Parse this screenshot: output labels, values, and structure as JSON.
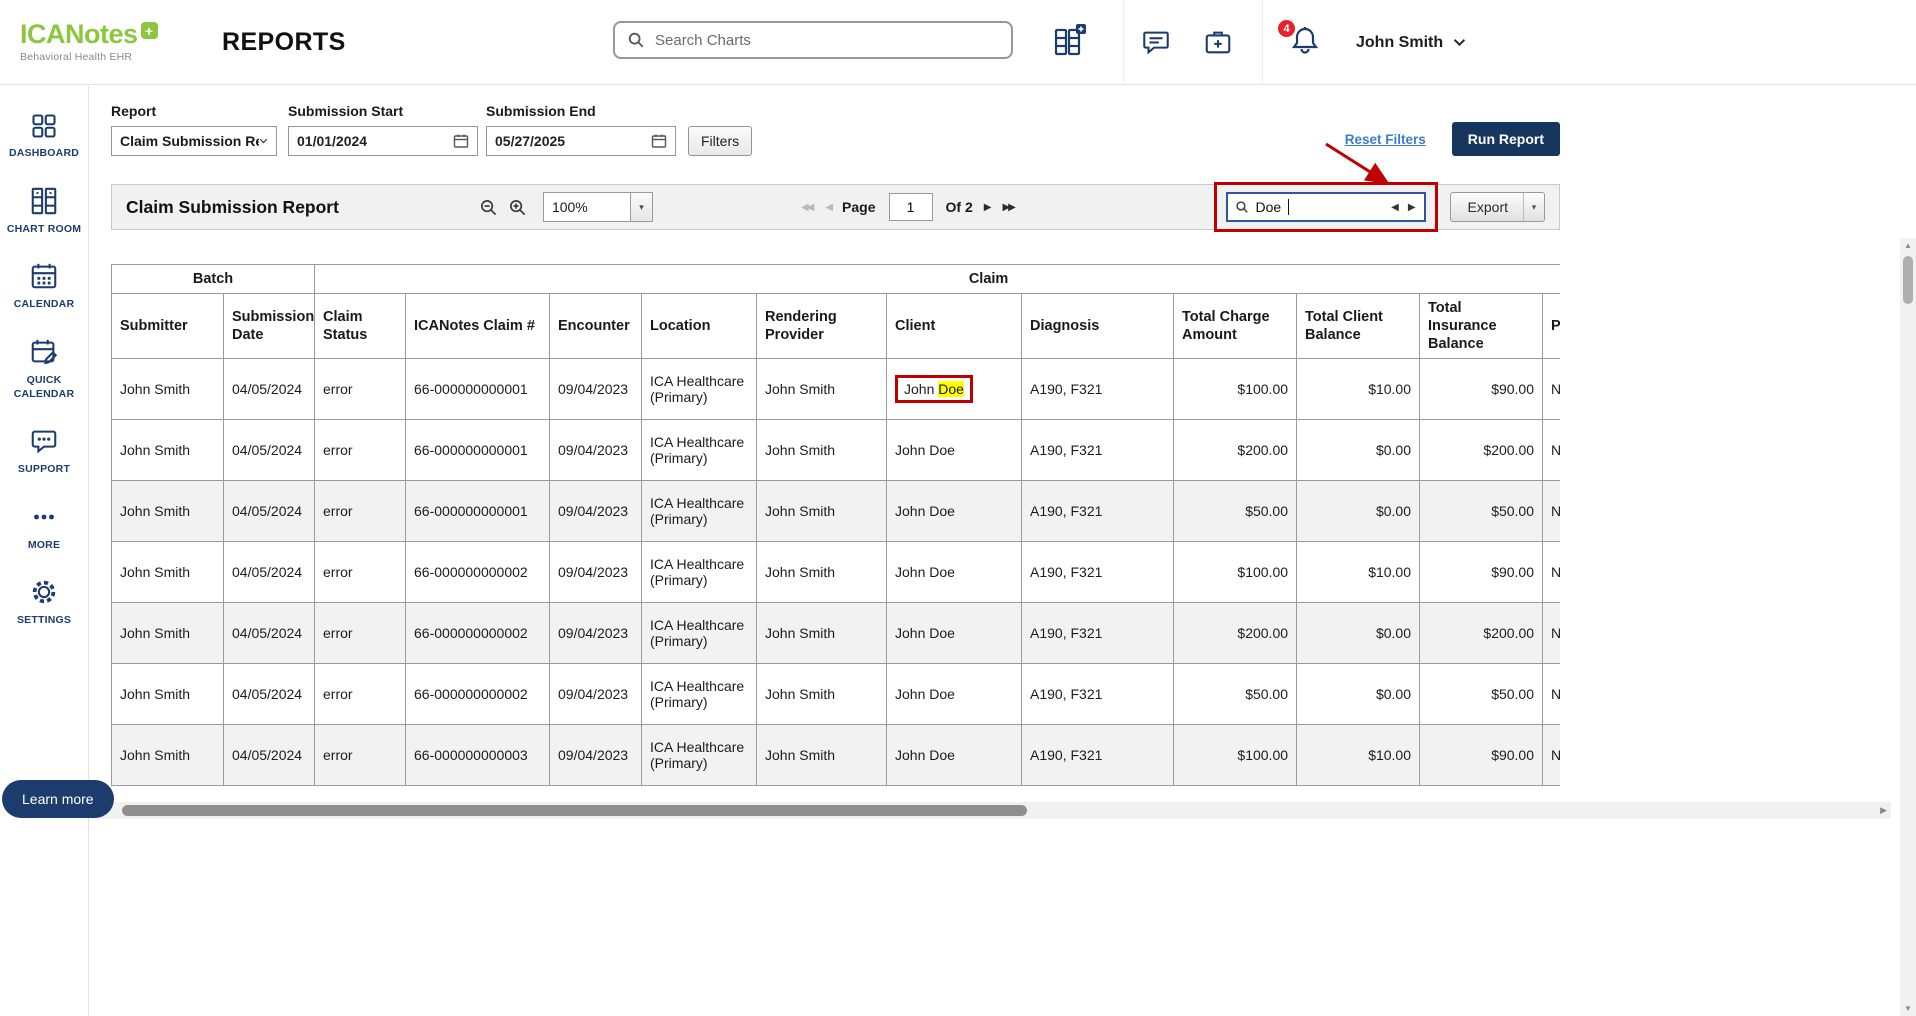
{
  "colors": {
    "accent_navy": "#1d3c6e",
    "button_navy": "#17365e",
    "logo_green": "#8dc63f",
    "annotation_red": "#c00000",
    "link_blue": "#3d7cc9",
    "highlight_yellow": "#ffff00",
    "badge_red": "#e8222d"
  },
  "header": {
    "logo_text": "ICANotes",
    "logo_plus": "+",
    "logo_tagline": "Behavioral Health EHR",
    "page_title": "REPORTS",
    "search_placeholder": "Search Charts",
    "notification_count": "4",
    "user_name": "John Smith"
  },
  "sidebar": {
    "items": [
      {
        "label": "DASHBOARD"
      },
      {
        "label": "CHART ROOM"
      },
      {
        "label": "CALENDAR"
      },
      {
        "label": "QUICK CALENDAR"
      },
      {
        "label": "SUPPORT"
      },
      {
        "label": "MORE"
      },
      {
        "label": "SETTINGS"
      }
    ],
    "learn_more_label": "Learn more"
  },
  "filters": {
    "report_label": "Report",
    "report_value": "Claim Submission Report",
    "start_label": "Submission Start",
    "start_value": "01/01/2024",
    "end_label": "Submission End",
    "end_value": "05/27/2025",
    "filters_button_label": "Filters",
    "reset_link_label": "Reset Filters",
    "run_button_label": "Run Report"
  },
  "toolbar": {
    "report_title": "Claim Submission Report",
    "zoom_value": "100%",
    "page_label": "Page",
    "page_value": "1",
    "page_total_label": "Of 2",
    "search_value": "Doe",
    "export_label": "Export"
  },
  "icons": {
    "first_page": "◀◀",
    "prev_page": "◀",
    "next_page": "▶",
    "last_page": "▶▶",
    "dropdown_arrow": "▾",
    "search_prev": "◀",
    "search_next": "▶",
    "hscroll_left": "◀",
    "hscroll_right": "▶",
    "vscroll_up": "▲",
    "vscroll_down": "▼"
  },
  "table": {
    "group_headers": [
      {
        "label": "Batch",
        "colspan": 2
      },
      {
        "label": "Claim",
        "colspan": 11
      }
    ],
    "columns": [
      "Submitter",
      "Submission Date",
      "Claim Status",
      "ICANotes Claim #",
      "Encounter",
      "Location",
      "Rendering Provider",
      "Client",
      "Diagnosis",
      "Total Charge Amount",
      "Total Client Balance",
      "Total Insurance Balance",
      "P"
    ],
    "rows": [
      {
        "submitter": "John Smith",
        "submission_date": "04/05/2024",
        "claim_status": "error",
        "claim_number": "66-000000000001",
        "encounter": "09/04/2023",
        "location": "ICA Healthcare (Primary)",
        "rendering_provider": "John Smith",
        "client": "John Doe",
        "diagnosis": "A190, F321",
        "total_charge": "$100.00",
        "total_client_balance": "$10.00",
        "total_insurance_balance": "$90.00",
        "partial": "N",
        "annotated": true
      },
      {
        "submitter": "John Smith",
        "submission_date": "04/05/2024",
        "claim_status": "error",
        "claim_number": "66-000000000001",
        "encounter": "09/04/2023",
        "location": "ICA Healthcare (Primary)",
        "rendering_provider": "John Smith",
        "client": "John Doe",
        "diagnosis": "A190, F321",
        "total_charge": "$200.00",
        "total_client_balance": "$0.00",
        "total_insurance_balance": "$200.00",
        "partial": "N",
        "annotated": false
      },
      {
        "submitter": "John Smith",
        "submission_date": "04/05/2024",
        "claim_status": "error",
        "claim_number": "66-000000000001",
        "encounter": "09/04/2023",
        "location": "ICA Healthcare (Primary)",
        "rendering_provider": "John Smith",
        "client": "John Doe",
        "diagnosis": "A190, F321",
        "total_charge": "$50.00",
        "total_client_balance": "$0.00",
        "total_insurance_balance": "$50.00",
        "partial": "N",
        "annotated": false
      },
      {
        "submitter": "John Smith",
        "submission_date": "04/05/2024",
        "claim_status": "error",
        "claim_number": "66-000000000002",
        "encounter": "09/04/2023",
        "location": "ICA Healthcare (Primary)",
        "rendering_provider": "John Smith",
        "client": "John Doe",
        "diagnosis": "A190, F321",
        "total_charge": "$100.00",
        "total_client_balance": "$10.00",
        "total_insurance_balance": "$90.00",
        "partial": "N",
        "annotated": false
      },
      {
        "submitter": "John Smith",
        "submission_date": "04/05/2024",
        "claim_status": "error",
        "claim_number": "66-000000000002",
        "encounter": "09/04/2023",
        "location": "ICA Healthcare (Primary)",
        "rendering_provider": "John Smith",
        "client": "John Doe",
        "diagnosis": "A190, F321",
        "total_charge": "$200.00",
        "total_client_balance": "$0.00",
        "total_insurance_balance": "$200.00",
        "partial": "N",
        "annotated": false
      },
      {
        "submitter": "John Smith",
        "submission_date": "04/05/2024",
        "claim_status": "error",
        "claim_number": "66-000000000002",
        "encounter": "09/04/2023",
        "location": "ICA Healthcare (Primary)",
        "rendering_provider": "John Smith",
        "client": "John Doe",
        "diagnosis": "A190, F321",
        "total_charge": "$50.00",
        "total_client_balance": "$0.00",
        "total_insurance_balance": "$50.00",
        "partial": "N",
        "annotated": false
      },
      {
        "submitter": "John Smith",
        "submission_date": "04/05/2024",
        "claim_status": "error",
        "claim_number": "66-000000000003",
        "encounter": "09/04/2023",
        "location": "ICA Healthcare (Primary)",
        "rendering_provider": "John Smith",
        "client": "John Doe",
        "diagnosis": "A190, F321",
        "total_charge": "$100.00",
        "total_client_balance": "$10.00",
        "total_insurance_balance": "$90.00",
        "partial": "N",
        "annotated": false
      }
    ]
  }
}
